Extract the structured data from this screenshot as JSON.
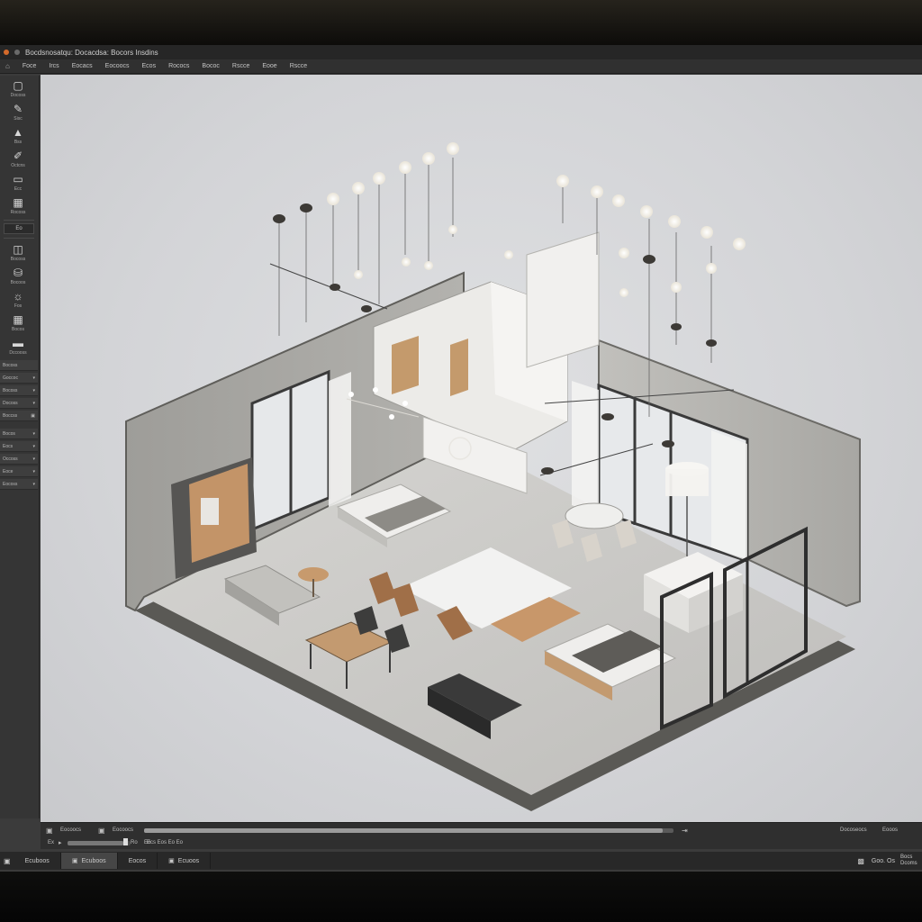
{
  "window": {
    "title": "Bocdsnosatqu: Docacdsa:   Bocors Insdins"
  },
  "menu": [
    "Foce",
    "Ircs",
    "Eocacs",
    "Eocoocs",
    "Ecos",
    "Rococs",
    "Bococ",
    "Rscce",
    "Eooe",
    "Rscce"
  ],
  "toolbar": {
    "tools": [
      {
        "label": "Docoss",
        "icon": "select-icon"
      },
      {
        "label": "Sisc",
        "icon": "pencil-icon"
      },
      {
        "label": "Bss",
        "icon": "home-icon"
      },
      {
        "label": "Octcns",
        "icon": "brush-icon"
      },
      {
        "label": "Ecc",
        "icon": "monitor-icon"
      },
      {
        "label": "Rocoss",
        "icon": "grid-icon"
      }
    ],
    "chip": "Eo",
    "tools2": [
      {
        "label": "Bocoss",
        "icon": "layers-icon"
      },
      {
        "label": "Bocoos",
        "icon": "paint-icon"
      },
      {
        "label": "Fos",
        "icon": "light-icon"
      },
      {
        "label": "Bocos",
        "icon": "table-icon"
      },
      {
        "label": "Dccooss",
        "icon": "sofa-icon"
      }
    ],
    "props": [
      "Bocoss",
      "Goccoc",
      "Bocoss",
      "Docoss",
      "Boccss",
      "Bocos",
      "Eocs",
      "Occoss",
      "Eoce",
      "Eocoss"
    ]
  },
  "timeline": {
    "left_label": "Eocoocs",
    "mid_label": "Eocoocs",
    "progress": 0.98,
    "right_label": "Docoseocs",
    "right_label2": "Eooos",
    "row2_left": "Ex",
    "row2_a": "Ro",
    "row2_b": "Eo",
    "row2_nums": "Ecs   Eos  Eo  Eo"
  },
  "status": {
    "tabs": [
      "Ecuboos",
      "Ecuboos",
      "Eocos",
      "Ecuoos"
    ],
    "right": "Goo. Os",
    "right2": "Bocs Dcoms"
  },
  "colors": {
    "accent": "#d46a2b",
    "floor": "#c9c8c6",
    "wall": "#a7a6a3",
    "wood": "#b58a5c"
  }
}
